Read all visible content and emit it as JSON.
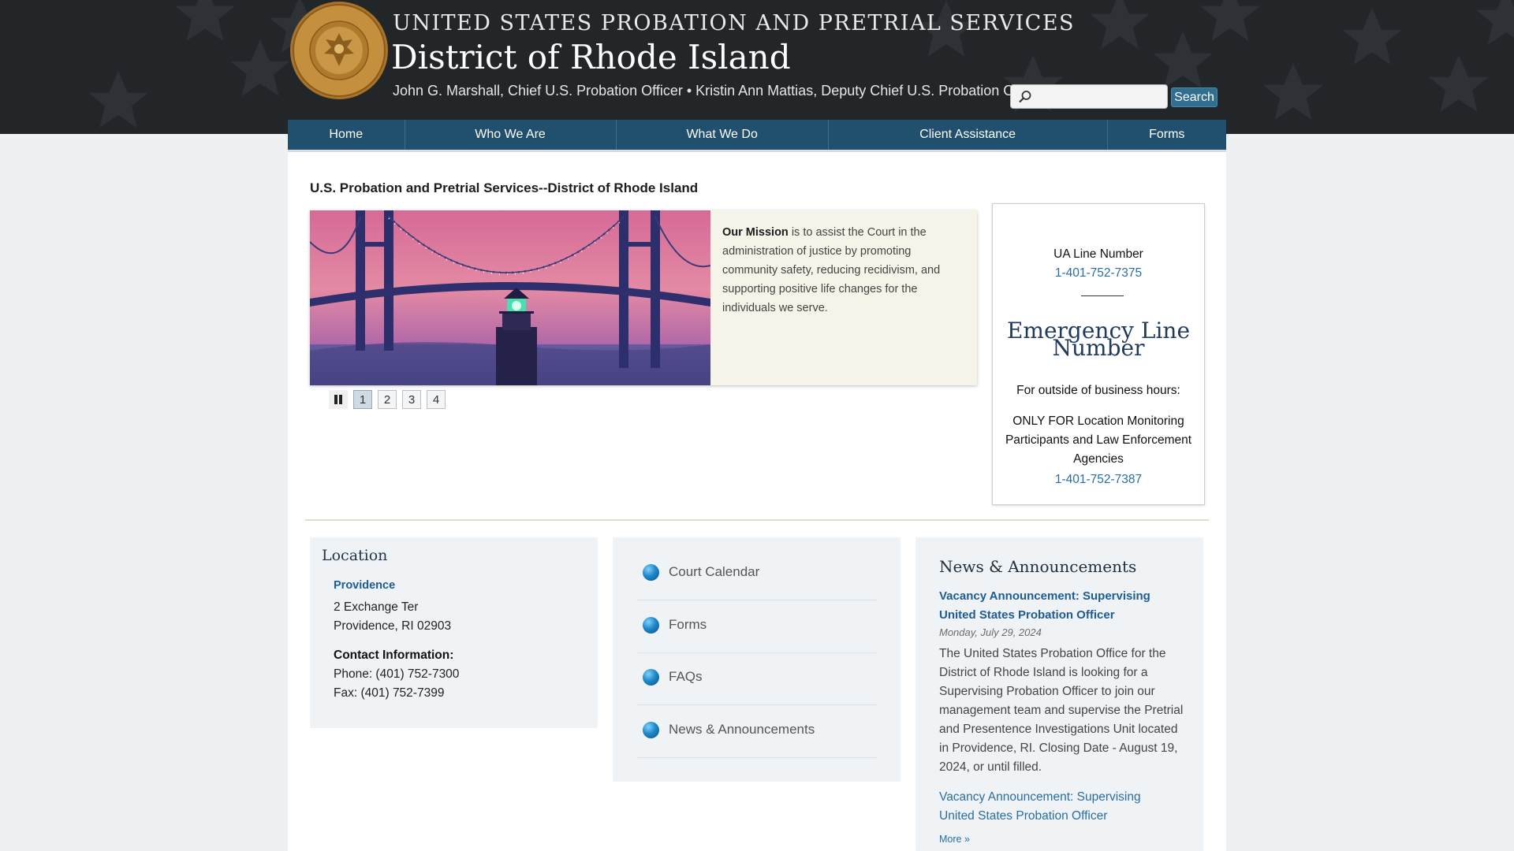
{
  "header": {
    "agency": "UNITED STATES PROBATION AND PRETRIAL SERVICES",
    "district": "District of Rhode Island",
    "officers": "John G. Marshall, Chief U.S. Probation Officer • Kristin Ann Mattias, Deputy Chief U.S. Probation Officer",
    "seal_text": "UNITED STATES PROBATION AND PRETRIAL SERVICES • DISTRICT OF RHODE ISLAND"
  },
  "search": {
    "placeholder": "",
    "button_label": "Search"
  },
  "nav": {
    "items": [
      {
        "label": "Home"
      },
      {
        "label": "Who We Are"
      },
      {
        "label": "What We Do"
      },
      {
        "label": "Client Assistance"
      },
      {
        "label": "Forms"
      }
    ]
  },
  "main": {
    "title": "U.S. Probation and Pretrial Services--District of Rhode Island",
    "slide": {
      "caption_bold": "Our Mission",
      "caption_text": " is to assist the Court in the administration of justice by promoting community safety, reducing recidivism, and supporting positive life changes for the individuals we serve."
    },
    "pager": {
      "pause_icon": "pause-icon",
      "pages": [
        "1",
        "2",
        "3",
        "4"
      ],
      "active_page": "1"
    }
  },
  "sidebar": {
    "ua_label": "UA Line Number",
    "ua_phone": "1-401-752-7375",
    "emergency_heading_line1": "Emergency Line",
    "emergency_heading_line2": "Number",
    "after_hours": "For outside of business hours:",
    "only_for": "ONLY FOR Location Monitoring Participants and Law Enforcement Agencies",
    "emergency_phone": "1-401-752-7387"
  },
  "location": {
    "title": "Location",
    "city": "Providence",
    "street": "2 Exchange Ter",
    "city_state_zip": "Providence, RI 02903",
    "contact_heading": "Contact Information:",
    "phone": "Phone: (401) 752-7300",
    "fax": "Fax: (401) 752-7399"
  },
  "quick_links": [
    {
      "label": "Court Calendar"
    },
    {
      "label": "Forms"
    },
    {
      "label": "FAQs"
    },
    {
      "label": "News & Announcements"
    }
  ],
  "news": {
    "title": "News & Announcements",
    "item_title": "Vacancy Announcement: Supervising United States Probation Officer",
    "item_date": "Monday, July 29, 2024",
    "item_body": "The United States Probation Office for the District of Rhode Island is looking for a Supervising Probation Officer to join our management team and supervise the Pretrial and Presentence Investigations Unit located in Providence, RI. Closing Date - August 19, 2024, or until filled.",
    "second_link": "Vacancy Announcement: Supervising United States Probation Officer",
    "more_label": "More »"
  },
  "colors": {
    "header_bg": "#222629",
    "nav_bg": "#21506e",
    "link": "#2b6ea0",
    "search_button": "#326e8f",
    "seal_gold": "#b07a2c"
  }
}
